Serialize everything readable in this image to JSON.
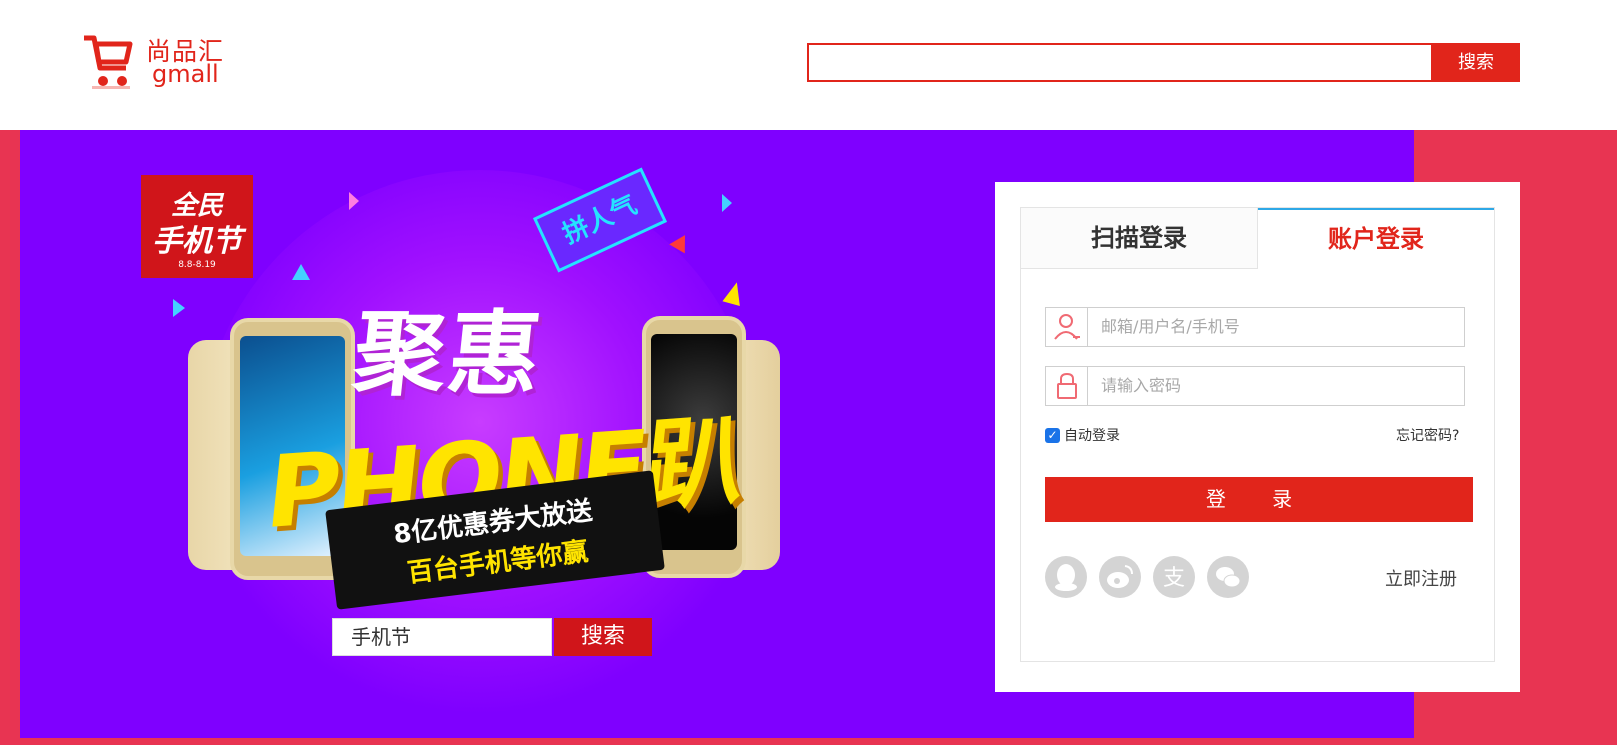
{
  "header": {
    "logo_cn": "尚品汇",
    "logo_en": "gmall",
    "search_value": "",
    "search_button": "搜索"
  },
  "promo": {
    "festival_line1": "全民",
    "festival_line2": "手机节",
    "festival_dates": "8.8-8.19",
    "tag": "拼人气",
    "title_cn": "聚惠",
    "title_en": "PHONE趴",
    "ribbon_line1": "8亿优惠券大放送",
    "ribbon_line2": "百台手机等你赢",
    "search_value": "手机节",
    "search_button": "搜索"
  },
  "login": {
    "tab_scan": "扫描登录",
    "tab_account": "账户登录",
    "active_tab": "tab_account",
    "username_placeholder": "邮箱/用户名/手机号",
    "password_placeholder": "请输入密码",
    "auto_login_label": "自动登录",
    "auto_login_checked": true,
    "forgot_password": "忘记密码?",
    "submit": "登 录",
    "register": "立即注册",
    "social_icons": [
      "qq-icon",
      "weibo-icon",
      "alipay-icon",
      "wechat-icon"
    ]
  },
  "colors": {
    "brand_red": "#e1251b",
    "banner_bg": "#e83452",
    "promo_bg": "#7f00ff",
    "tab_accent": "#2ea8e6"
  }
}
